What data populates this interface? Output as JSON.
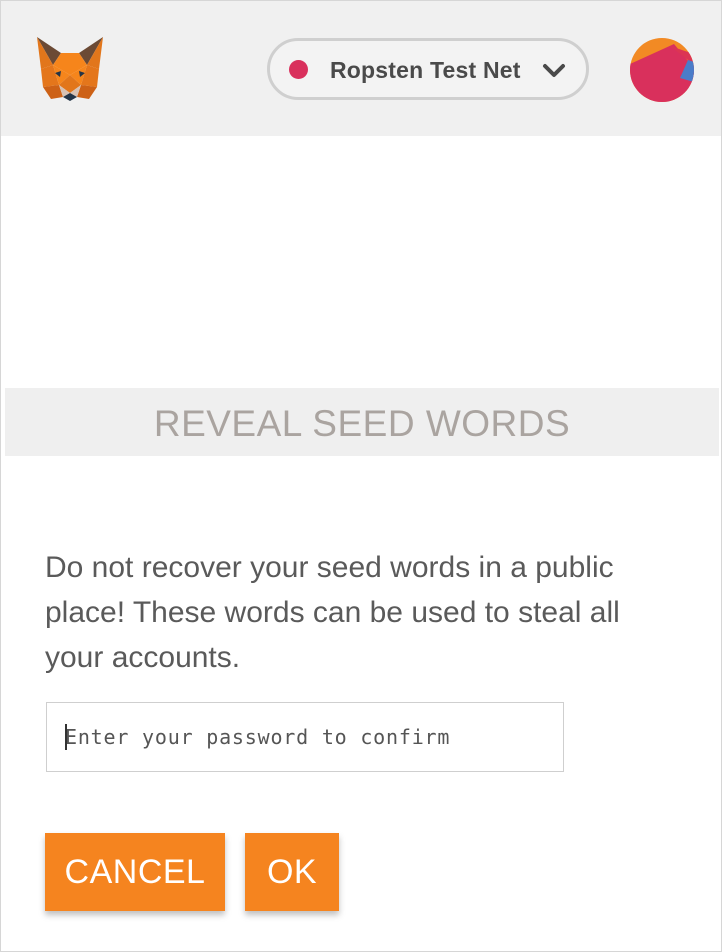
{
  "header": {
    "network": {
      "name": "Ropsten Test Net",
      "dot_color": "#d9305c"
    },
    "icons": {
      "logo": "metamask-fox-icon",
      "dropdown": "chevron-down-icon",
      "account": "account-identicon"
    }
  },
  "banner": {
    "title": "REVEAL SEED WORDS"
  },
  "main": {
    "warning": "Do not recover your seed words in a public place! These words can be used to steal all your accounts.",
    "password": {
      "placeholder": "Enter your password to confirm",
      "value": ""
    },
    "buttons": {
      "cancel": "CANCEL",
      "ok": "OK"
    }
  },
  "colors": {
    "accent": "#f5841f",
    "header_bg": "#f0f0f0",
    "banner_text": "#aaa4a0"
  }
}
